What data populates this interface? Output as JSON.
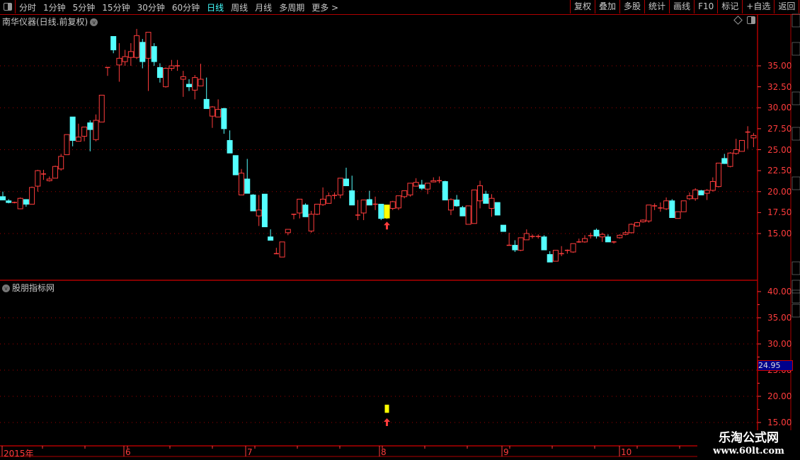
{
  "toolbar": {
    "periods": [
      "分时",
      "1分钟",
      "5分钟",
      "15分钟",
      "30分钟",
      "60分钟",
      "日线",
      "周线",
      "月线",
      "多周期",
      "更多 >"
    ],
    "active_period": "日线",
    "buttons": [
      "复权",
      "叠加",
      "多股",
      "统计",
      "画线",
      "F10",
      "标记",
      "+自选",
      "返回"
    ]
  },
  "main": {
    "title": "南华仪器(日线.前复权)"
  },
  "indicator": {
    "title": "股朋指标网",
    "current_price_label": "24.95"
  },
  "colors": {
    "up": "#ff3c3c",
    "down": "#54ffff",
    "signal": "#ffff00",
    "axis": "#ff3c3c",
    "border": "#b00000",
    "price_box": "#00008b"
  },
  "watermark": {
    "line1": "乐淘公式网",
    "line2": "www.60lt.com"
  },
  "chart_data": {
    "type": "candlestick",
    "main_yaxis": {
      "ticks": [
        "35.00",
        "32.50",
        "30.00",
        "27.50",
        "25.00",
        "22.50",
        "20.00",
        "17.50",
        "15.00"
      ],
      "grid": [
        35,
        30,
        25,
        20,
        15
      ],
      "ylim": [
        9.5,
        40
      ]
    },
    "indicator_yaxis": {
      "ticks": [
        "40.00",
        "35.00",
        "30.00",
        "25.00",
        "20.00",
        "15.00"
      ],
      "grid": [
        35,
        30,
        25,
        20,
        15
      ],
      "ylim": [
        13.5,
        41
      ]
    },
    "xaxis_labels": [
      "2015年",
      "6",
      "7",
      "8",
      "9",
      "10"
    ],
    "signal_index": 66,
    "ohlc": [
      [
        19.4,
        20.0,
        19.0,
        19.0
      ],
      [
        18.9,
        19.1,
        18.6,
        18.7
      ],
      [
        18.7,
        18.8,
        18.6,
        18.7
      ],
      [
        17.95,
        19.3,
        17.9,
        19.2
      ],
      [
        19.05,
        19.1,
        18.2,
        18.5
      ],
      [
        18.5,
        20.6,
        18.5,
        20.5
      ],
      [
        20.65,
        22.6,
        20.0,
        22.5
      ],
      [
        22.1,
        22.6,
        21.4,
        22.1
      ],
      [
        21.3,
        21.8,
        21.2,
        21.5
      ],
      [
        21.6,
        23.1,
        21.6,
        23.0
      ],
      [
        22.7,
        24.5,
        22.5,
        24.2
      ],
      [
        24.4,
        26.8,
        24.4,
        26.8
      ],
      [
        28.9,
        28.9,
        25.4,
        26.1
      ],
      [
        26.0,
        28.1,
        26.0,
        26.5
      ],
      [
        26.6,
        27.7,
        26.0,
        27.7
      ],
      [
        28.2,
        28.5,
        24.8,
        27.4
      ],
      [
        26.2,
        29.2,
        26.0,
        28.5
      ],
      [
        28.3,
        31.5,
        28.3,
        31.5
      ],
      [
        34.8,
        34.8,
        33.8,
        34.8
      ],
      [
        38.5,
        38.5,
        36.5,
        36.9
      ],
      [
        35.1,
        37.7,
        33.1,
        35.9
      ],
      [
        35.5,
        36.9,
        35.0,
        36.1
      ],
      [
        36.0,
        37.7,
        35.0,
        36.7
      ],
      [
        36.0,
        39.4,
        35.8,
        38.6
      ],
      [
        37.8,
        38.2,
        34.7,
        35.5
      ],
      [
        35.9,
        39.0,
        32.0,
        39.0
      ],
      [
        37.3,
        37.7,
        35.0,
        35.5
      ],
      [
        34.8,
        35.3,
        33.0,
        33.6
      ],
      [
        32.5,
        34.8,
        32.4,
        34.7
      ],
      [
        34.7,
        35.7,
        34.4,
        35.0
      ],
      [
        35.0,
        35.7,
        34.4,
        35.0
      ],
      [
        33.4,
        34.4,
        31.3,
        33.7
      ],
      [
        32.8,
        33.4,
        32.0,
        32.5
      ],
      [
        32.1,
        33.9,
        31.0,
        33.6
      ],
      [
        32.6,
        35.25,
        32.6,
        33.4
      ],
      [
        31.0,
        33.6,
        29.9,
        29.9
      ],
      [
        29.0,
        30.2,
        27.6,
        30.1
      ],
      [
        28.9,
        31.0,
        28.9,
        29.8
      ],
      [
        29.9,
        30.0,
        26.9,
        27.5
      ],
      [
        26.1,
        27.3,
        24.6,
        24.6
      ],
      [
        24.3,
        24.3,
        22.0,
        22.0
      ],
      [
        19.6,
        22.7,
        19.6,
        22.2
      ],
      [
        21.5,
        23.9,
        19.8,
        19.8
      ],
      [
        19.6,
        19.7,
        17.7,
        17.7
      ],
      [
        17.1,
        19.6,
        15.9,
        17.8
      ],
      [
        19.7,
        19.7,
        15.8,
        15.8
      ],
      [
        14.6,
        15.5,
        14.2,
        14.2
      ],
      [
        12.6,
        13.3,
        12.6,
        12.6
      ],
      [
        12.2,
        14.0,
        12.2,
        14.0
      ],
      [
        15.1,
        15.5,
        14.8,
        15.5
      ],
      [
        17.3,
        17.3,
        16.7,
        17.3
      ],
      [
        17.45,
        19.1,
        16.8,
        19.1
      ],
      [
        18.4,
        18.6,
        17.0,
        17.0
      ],
      [
        15.3,
        17.7,
        15.1,
        17.3
      ],
      [
        17.3,
        18.5,
        17.2,
        18.5
      ],
      [
        18.45,
        20.5,
        18.3,
        19.1
      ],
      [
        18.6,
        19.9,
        18.6,
        19.5
      ],
      [
        19.55,
        19.9,
        19.1,
        19.55
      ],
      [
        19.6,
        21.6,
        19.2,
        21.6
      ],
      [
        21.5,
        22.85,
        20.7,
        20.7
      ],
      [
        20.1,
        21.9,
        18.4,
        18.4
      ],
      [
        17.2,
        19.0,
        16.6,
        17.2
      ],
      [
        17.45,
        19.0,
        16.6,
        19.0
      ],
      [
        19.05,
        20.1,
        18.4,
        18.4
      ],
      [
        18.4,
        19.4,
        17.8,
        18.5
      ],
      [
        18.5,
        18.5,
        16.6,
        16.8
      ],
      [
        16.85,
        18.4,
        16.75,
        18.4
      ],
      [
        18.0,
        18.9,
        17.8,
        18.8
      ],
      [
        18.05,
        19.5,
        17.8,
        19.5
      ],
      [
        19.4,
        20.1,
        19.2,
        20.1
      ],
      [
        19.6,
        21.0,
        19.4,
        21.0
      ],
      [
        20.65,
        21.6,
        20.6,
        21.1
      ],
      [
        20.8,
        21.4,
        20.2,
        20.4
      ],
      [
        20.3,
        21.0,
        19.7,
        21.0
      ],
      [
        21.15,
        21.7,
        21.1,
        21.3
      ],
      [
        21.3,
        21.8,
        21.0,
        21.3
      ],
      [
        21.2,
        21.3,
        19.0,
        19.0
      ],
      [
        17.8,
        19.2,
        17.2,
        19.05
      ],
      [
        19.0,
        19.6,
        18.2,
        18.3
      ],
      [
        18.1,
        18.3,
        17.1,
        17.1
      ],
      [
        16.1,
        18.3,
        16.1,
        18.3
      ],
      [
        16.2,
        20.2,
        16.2,
        20.2
      ],
      [
        18.9,
        21.3,
        18.0,
        20.7
      ],
      [
        19.7,
        20.1,
        18.6,
        18.6
      ],
      [
        18.0,
        19.7,
        17.0,
        19.2
      ],
      [
        18.7,
        18.7,
        17.2,
        17.2
      ],
      [
        16.0,
        16.0,
        15.25,
        15.25
      ],
      [
        13.6,
        15.1,
        13.6,
        13.6
      ],
      [
        13.6,
        14.2,
        12.8,
        13.05
      ],
      [
        13.0,
        14.5,
        12.9,
        14.5
      ],
      [
        14.25,
        15.5,
        14.25,
        15.0
      ],
      [
        14.65,
        14.9,
        14.4,
        14.65
      ],
      [
        14.65,
        14.9,
        14.4,
        14.65
      ],
      [
        14.6,
        14.8,
        13.05,
        13.05
      ],
      [
        12.5,
        12.9,
        11.6,
        11.6
      ],
      [
        11.7,
        13.0,
        11.7,
        13.0
      ],
      [
        12.6,
        13.5,
        12.3,
        12.6
      ],
      [
        13.0,
        13.1,
        12.6,
        13.0
      ],
      [
        12.8,
        13.8,
        12.7,
        13.8
      ],
      [
        14.0,
        14.4,
        13.9,
        14.0
      ],
      [
        14.0,
        14.8,
        13.9,
        14.4
      ],
      [
        14.75,
        15.1,
        14.4,
        14.75
      ],
      [
        15.4,
        15.6,
        14.4,
        14.7
      ],
      [
        14.6,
        15.1,
        14.0,
        14.9
      ],
      [
        14.6,
        14.9,
        14.2,
        14.0
      ],
      [
        14.0,
        14.1,
        13.8,
        14.0
      ],
      [
        14.5,
        14.9,
        14.4,
        14.8
      ],
      [
        14.9,
        15.3,
        14.8,
        15.1
      ],
      [
        15.1,
        16.2,
        15.0,
        16.1
      ],
      [
        15.9,
        16.4,
        15.8,
        16.3
      ],
      [
        16.4,
        16.7,
        16.3,
        16.6
      ],
      [
        16.5,
        18.4,
        16.3,
        18.4
      ],
      [
        18.3,
        18.6,
        17.8,
        18.3
      ],
      [
        18.05,
        18.7,
        17.6,
        18.05
      ],
      [
        17.95,
        19.3,
        17.8,
        18.9
      ],
      [
        18.9,
        19.1,
        16.9,
        16.9
      ],
      [
        16.8,
        17.6,
        16.8,
        17.6
      ],
      [
        17.6,
        18.9,
        17.6,
        18.9
      ],
      [
        19.15,
        19.9,
        19.0,
        19.5
      ],
      [
        19.15,
        20.4,
        18.9,
        20.2
      ],
      [
        20.1,
        20.2,
        19.6,
        19.6
      ],
      [
        19.8,
        20.3,
        19.0,
        20.15
      ],
      [
        20.15,
        21.7,
        20.0,
        21.2
      ],
      [
        20.6,
        23.4,
        20.5,
        23.4
      ],
      [
        23.95,
        24.5,
        23.3,
        23.35
      ],
      [
        23.0,
        24.7,
        22.9,
        24.6
      ],
      [
        24.55,
        26.3,
        24.4,
        25.0
      ],
      [
        24.8,
        26.1,
        24.8,
        26.1
      ],
      [
        27.1,
        27.8,
        25.1,
        27.1
      ],
      [
        26.4,
        27.0,
        25.3,
        26.7
      ]
    ]
  }
}
